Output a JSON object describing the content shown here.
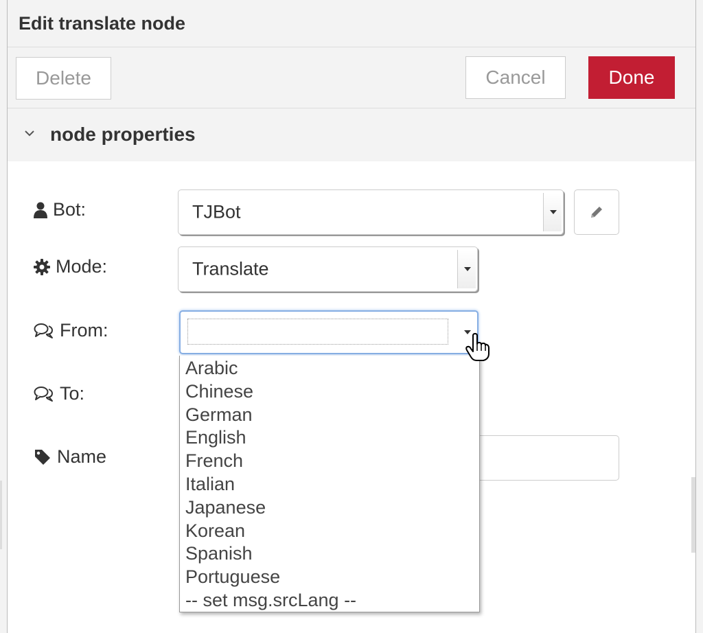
{
  "header": {
    "title": "Edit translate node"
  },
  "toolbar": {
    "delete_label": "Delete",
    "cancel_label": "Cancel",
    "done_label": "Done"
  },
  "section": {
    "title": "node properties"
  },
  "form": {
    "bot": {
      "label": "Bot:",
      "value": "TJBot",
      "icon": "user-icon"
    },
    "mode": {
      "label": "Mode:",
      "value": "Translate",
      "icon": "gear-icon"
    },
    "from": {
      "label": "From:",
      "value": "",
      "icon": "comments-icon"
    },
    "to": {
      "label": "To:",
      "icon": "comments-icon"
    },
    "name": {
      "label": "Name",
      "value": "",
      "icon": "tag-icon"
    }
  },
  "dropdown": {
    "options": [
      "Arabic",
      "Chinese",
      "German",
      "English",
      "French",
      "Italian",
      "Japanese",
      "Korean",
      "Spanish",
      "Portuguese",
      "-- set msg.srcLang --"
    ]
  },
  "colors": {
    "done": "#c21e33",
    "focus": "#86aee3"
  }
}
